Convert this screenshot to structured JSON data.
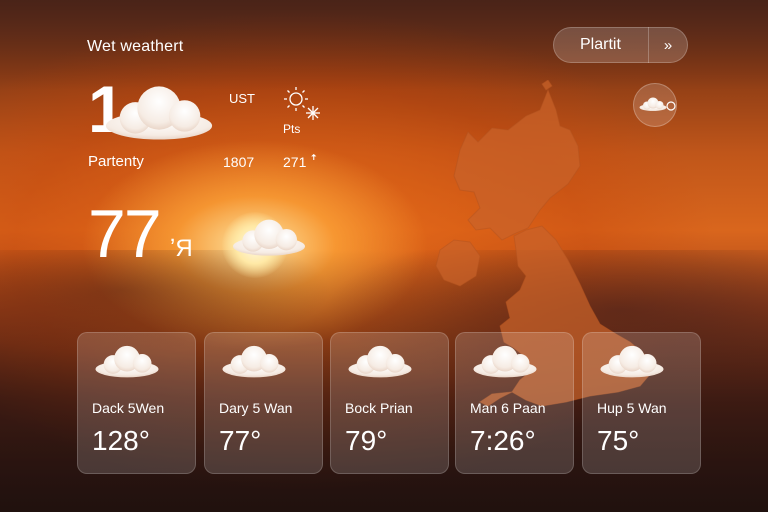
{
  "header": {
    "app_title": "Wet weathert",
    "action_label": "Plartit",
    "action_chevron": "»"
  },
  "current": {
    "big_number": "1",
    "ust_label": "UST",
    "pts_label": "Pts",
    "location": "Partenty",
    "stat_1": "1807",
    "stat_2": "271 ꜛ",
    "temperature": "77",
    "unit": "ʼЯ"
  },
  "icons": {
    "hero": "cloud-icon",
    "weather_small": "sun-snow-icon",
    "badge": "cloud-icon",
    "map": "uk-map",
    "forecast": "cloud-icon"
  },
  "forecast": [
    {
      "day": "Dack 5Wen",
      "temp": "128°"
    },
    {
      "day": "Dary 5 Wan",
      "temp": "77°"
    },
    {
      "day": "Bock Prian",
      "temp": "79°"
    },
    {
      "day": "Man 6 Paan",
      "temp": "7:26°"
    },
    {
      "day": "Hup 5 Wan",
      "temp": "75°"
    }
  ],
  "colors": {
    "accent": "#d9661d",
    "map_fill": "#c9622a"
  }
}
